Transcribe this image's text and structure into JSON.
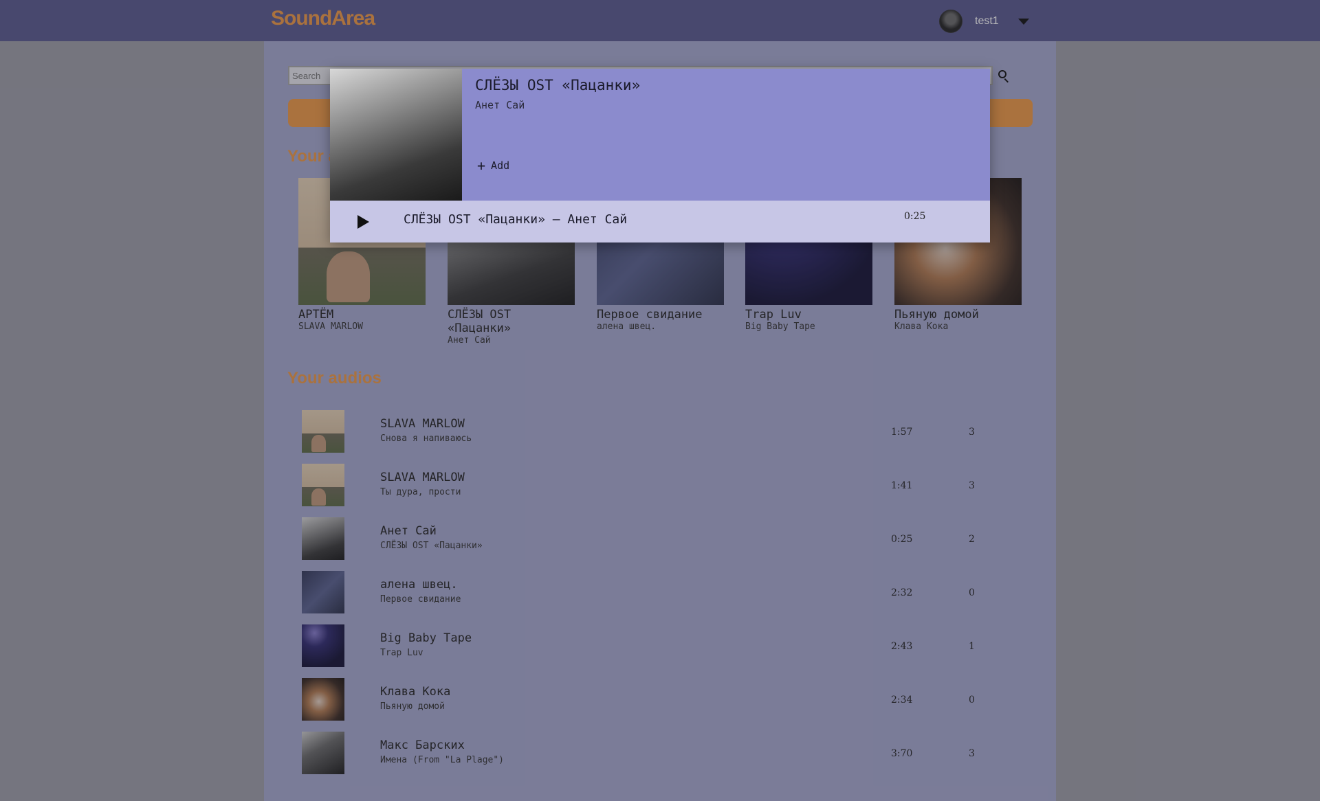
{
  "header": {
    "logo": "SoundArea",
    "username": "test1"
  },
  "search": {
    "placeholder": "Search"
  },
  "sections": {
    "albums_title": "Your albums",
    "audios_title": "Your audios"
  },
  "albums": [
    {
      "title": "АРТЁМ",
      "artist": "SLAVA MARLOW"
    },
    {
      "title": "СЛЁЗЫ OST «Пацанки»",
      "artist": "Анет Сай"
    },
    {
      "title": "Первое свидание",
      "artist": "алена швец."
    },
    {
      "title": "Trap Luv",
      "artist": "Big Baby Tape"
    },
    {
      "title": "Пьяную домой",
      "artist": "Клава Кока"
    }
  ],
  "tracks": [
    {
      "artist": "SLAVA MARLOW",
      "title": "Снова я напиваюсь",
      "duration": "1:57",
      "count": "3"
    },
    {
      "artist": "SLAVA MARLOW",
      "title": "Ты дура, прости",
      "duration": "1:41",
      "count": "3"
    },
    {
      "artist": "Анет Сай",
      "title": "СЛЁЗЫ OST «Пацанки»",
      "duration": "0:25",
      "count": "2"
    },
    {
      "artist": "алена швец.",
      "title": "Первое свидание",
      "duration": "2:32",
      "count": "0"
    },
    {
      "artist": "Big Baby Tape",
      "title": "Trap Luv",
      "duration": "2:43",
      "count": "1"
    },
    {
      "artist": "Клава Кока",
      "title": "Пьяную домой",
      "duration": "2:34",
      "count": "0"
    },
    {
      "artist": "Макс Барских",
      "title": "Имена (From \"La Plage\")",
      "duration": "3:70",
      "count": "3"
    }
  ],
  "modal": {
    "title": "СЛЁЗЫ OST «Пацанки»",
    "artist": "Анет Сай",
    "add_label": "Add",
    "track_title": "СЛЁЗЫ OST «Пацанки» – Анет Сай",
    "duration": "0:25"
  },
  "colors": {
    "accent": "#f09a45",
    "header": "#5a5a8f",
    "modal": "#8b8bcd"
  }
}
